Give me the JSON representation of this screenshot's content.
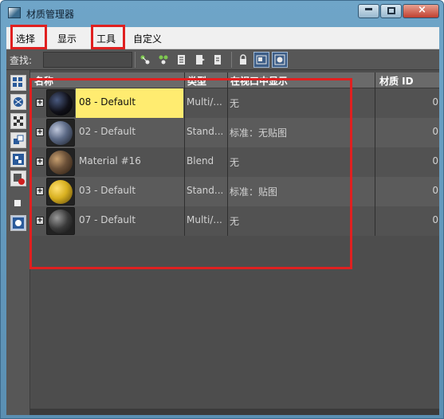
{
  "window": {
    "title": "材质管理器",
    "min_label": "—",
    "close_label": "×"
  },
  "menu": {
    "items": [
      "选择",
      "显示",
      "工具",
      "自定义"
    ]
  },
  "toolbar": {
    "find_label": "查找:",
    "find_value": "",
    "buttons": [
      "select-children-icon",
      "select-all-icon",
      "list-icon",
      "list-export-icon",
      "list-import-icon",
      "lock-icon",
      "material-scene-icon",
      "material-view-icon"
    ]
  },
  "sidebar": {
    "buttons": [
      "display-scene-icon",
      "display-materials-icon",
      "display-maps-icon",
      "display-objects-icon",
      "display-hierarchy-icon",
      "display-incompatible-icon",
      "display-selection-icon",
      "display-all-icon"
    ]
  },
  "table": {
    "headers": {
      "name": "名称",
      "type": "类型",
      "display": "在视口中显示",
      "id": "材质 ID"
    },
    "rows": [
      {
        "name": "08 - Default",
        "type": "Multi/...",
        "display": "无",
        "id": "0",
        "selected": true,
        "sphere_color": "#1a1a2a"
      },
      {
        "name": "02 - Default",
        "type": "Stand...",
        "display": "标准：无贴图",
        "id": "0",
        "selected": false,
        "sphere_color": "#5c6a86"
      },
      {
        "name": "Material #16",
        "type": "Blend",
        "display": "无",
        "id": "0",
        "selected": false,
        "sphere_color": "#6a5038"
      },
      {
        "name": "03 - Default",
        "type": "Stand...",
        "display": "标准：贴图",
        "id": "0",
        "selected": false,
        "sphere_color": "#d8b020"
      },
      {
        "name": "07 - Default",
        "type": "Multi/...",
        "display": "无",
        "id": "0",
        "selected": false,
        "sphere_color": "#3a3a3a"
      }
    ]
  },
  "colors": {
    "highlight": "#e02020",
    "selection": "#ffec70",
    "panel_bg": "#4d4d4d"
  }
}
